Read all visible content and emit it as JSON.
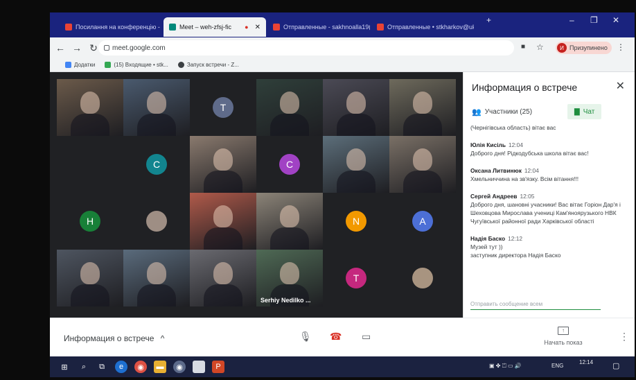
{
  "browser": {
    "tabs": [
      {
        "title": "Посилання на конференцію - ",
        "active": false,
        "icon": "gmail-icon"
      },
      {
        "title": "Meet – weh-zfsj-fic",
        "active": true,
        "icon": "meet-icon"
      },
      {
        "title": "Отправленные - sakhnoalla19( ",
        "active": false,
        "icon": "gmail-icon"
      },
      {
        "title": "Отправленные • stkharkov@uk ",
        "active": false,
        "icon": "gmail-icon"
      }
    ],
    "url": "meet.google.com",
    "profile_initial": "И",
    "profile_label": "Призупинено",
    "bookmarks": [
      {
        "label": "Додатки",
        "icon": "apps-icon"
      },
      {
        "label": "(15) Входящие • stk...",
        "icon": "inbox-icon"
      },
      {
        "label": "Запуск встречи - Z...",
        "icon": "zoom-icon"
      }
    ]
  },
  "participant_tiles": [
    {
      "type": "video",
      "color": "#6b5a4a"
    },
    {
      "type": "video",
      "color": "#4a5a6e"
    },
    {
      "type": "avatar",
      "initial": "T",
      "color": "#5f6b8a"
    },
    {
      "type": "video",
      "color": "#2f3f3a"
    },
    {
      "type": "video",
      "color": "#4b4a55"
    },
    {
      "type": "video",
      "color": "#6e6a5c"
    },
    {
      "type": "avatar",
      "initial": "C",
      "color": "#12858f"
    },
    {
      "type": "video",
      "color": "#8a7a6e"
    },
    {
      "type": "avatar",
      "initial": "C",
      "color": "#a142c4"
    },
    {
      "type": "video",
      "color": "#5c6e7a"
    },
    {
      "type": "video",
      "color": "#7a7066"
    },
    {
      "type": "avatar",
      "initial": "H",
      "color": "#188038"
    },
    {
      "type": "avatar-photo",
      "color": "#9e8e84"
    },
    {
      "type": "video",
      "color": "#b05a4a"
    },
    {
      "type": "video",
      "color": "#8c8478"
    },
    {
      "type": "avatar",
      "initial": "N",
      "color": "#f29900"
    },
    {
      "type": "avatar",
      "initial": "A",
      "color": "#4c6fd6"
    },
    {
      "type": "video",
      "color": "#4e5560"
    },
    {
      "type": "video",
      "color": "#5a6b7c"
    },
    {
      "type": "video",
      "color": "#6a6a70"
    },
    {
      "type": "video",
      "color": "#4f6a55",
      "name": "Serhiy Nedilko ..."
    },
    {
      "type": "avatar",
      "initial": "T",
      "color": "#c5287e"
    },
    {
      "type": "avatar-photo",
      "color": "#a89480"
    }
  ],
  "panel": {
    "title": "Информация о встрече",
    "participants_tab": "Участники (25)",
    "chat_tab": "Чат",
    "messages": [
      {
        "author": "",
        "time": "",
        "text": "(Чернігівська область) вітає вас"
      },
      {
        "author": "Юлія Кисіль",
        "time": "12:04",
        "text": "Доброго дня! Рідкодубська школа вітає вас!"
      },
      {
        "author": "Оксана Литвинюк",
        "time": "12:04",
        "text": "Хмельниччина на зв'язку. Всім вітання!!!"
      },
      {
        "author": "Сергей Андреев",
        "time": "12:05",
        "text": "Доброго дня, шановні учасники! Вас вітає Горіон Дар'я і Шеховцова Мирослава учениці Кам'яноярузького НВК Чугуївської районної ради Харківської області"
      },
      {
        "author": "Надія Баско",
        "time": "12:12",
        "text": "Музей тут ))\nзаступник директора Надія Баско"
      }
    ],
    "composer_placeholder": "Отправить сообщение всем"
  },
  "meetbar": {
    "info_label": "Информация о встрече",
    "present_label": "Начать показ"
  },
  "taskbar": {
    "lang": "ENG",
    "time": "12:14"
  }
}
